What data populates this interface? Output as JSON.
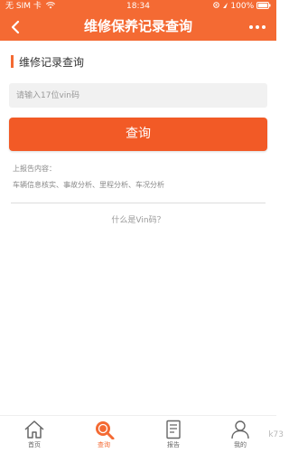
{
  "status_bar": {
    "carrier": "无 SIM 卡",
    "time": "18:34",
    "battery": "100%"
  },
  "header": {
    "title": "维修保养记录查询",
    "back_icon": "chevron-left-icon",
    "more_icon": "more-dots-icon",
    "background": "#f46a33"
  },
  "section": {
    "title": "维修记录查询"
  },
  "search": {
    "placeholder": "请输入17位vin码",
    "value": ""
  },
  "query_button": {
    "label": "查询",
    "color": "#f25a26"
  },
  "report": {
    "label": "上报告内容：",
    "items": "车辆信息核实、事故分析、里程分析、车况分析"
  },
  "help": {
    "text": "什么是Vin码？"
  },
  "tabbar": {
    "tabs": [
      {
        "label": "首页",
        "icon": "home-icon",
        "active": false
      },
      {
        "label": "查询",
        "icon": "magnifier-icon",
        "active": true
      },
      {
        "label": "报告",
        "icon": "document-icon",
        "active": false
      },
      {
        "label": "我的",
        "icon": "user-icon",
        "active": false
      }
    ],
    "active_color": "#f46a33"
  },
  "watermark": {
    "text": "k73"
  }
}
